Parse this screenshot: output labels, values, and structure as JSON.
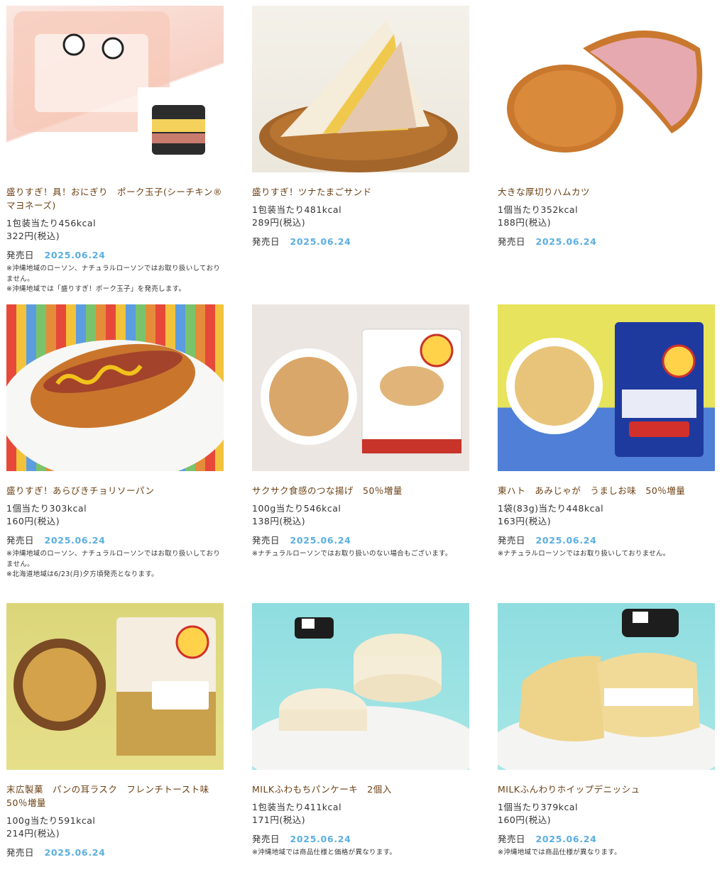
{
  "products": [
    {
      "name": "盛りすぎ！具！おにぎり　ポーク玉子(シーチキン®マヨネーズ)",
      "spec1": "1包装当たり456kcal",
      "spec2": "322円(税込)",
      "release_label": "発売日",
      "release_date": "2025.06.24",
      "notes": [
        "※沖縄地域のローソン、ナチュラルローソンではお取り扱いしておりません。",
        "※沖縄地域では「盛りすぎ！ポーク玉子」を発売します。"
      ],
      "image_icon": "onigiri-image"
    },
    {
      "name": "盛りすぎ！ツナたまごサンド",
      "spec1": "1包装当たり481kcal",
      "spec2": "289円(税込)",
      "release_label": "発売日",
      "release_date": "2025.06.24",
      "notes": [],
      "image_icon": "sandwich-image"
    },
    {
      "name": "大きな厚切りハムカツ",
      "spec1": "1個当たり352kcal",
      "spec2": "188円(税込)",
      "release_label": "発売日",
      "release_date": "2025.06.24",
      "notes": [],
      "image_icon": "ham-cutlet-image"
    },
    {
      "name": "盛りすぎ！あらびきチョリソーパン",
      "spec1": "1個当たり303kcal",
      "spec2": "160円(税込)",
      "release_label": "発売日",
      "release_date": "2025.06.24",
      "notes": [
        "※沖縄地域のローソン、ナチュラルローソンではお取り扱いしておりません。",
        "※北海道地域は6/23(月)夕方頃発売となります。"
      ],
      "image_icon": "chorizo-bread-image"
    },
    {
      "name": "サクサク食感のつな揚げ　50％増量",
      "spec1": "100g当たり546kcal",
      "spec2": "138円(税込)",
      "release_label": "発売日",
      "release_date": "2025.06.24",
      "notes": [
        "※ナチュラルローソンではお取り扱いのない場合もございます。"
      ],
      "image_icon": "snack-bag-image"
    },
    {
      "name": "東ハト　あみじゃが　うましお味　50％増量",
      "spec1": "1袋(83g)当たり448kcal",
      "spec2": "163円(税込)",
      "release_label": "発売日",
      "release_date": "2025.06.24",
      "notes": [
        "※ナチュラルローソンではお取り扱いしておりません。"
      ],
      "image_icon": "amijaga-image"
    },
    {
      "name": "末広製菓　パンの耳ラスク　フレンチトースト味　50％増量",
      "spec1": "100g当たり591kcal",
      "spec2": "214円(税込)",
      "release_label": "発売日",
      "release_date": "2025.06.24",
      "notes": [],
      "image_icon": "rusk-image"
    },
    {
      "name": "MILKふわもちパンケーキ　2個入",
      "spec1": "1包装当たり411kcal",
      "spec2": "171円(税込)",
      "release_label": "発売日",
      "release_date": "2025.06.24",
      "notes": [
        "※沖縄地域では商品仕様と価格が異なります。"
      ],
      "image_icon": "pancake-image"
    },
    {
      "name": "MILKふんわりホイップデニッシュ",
      "spec1": "1個当たり379kcal",
      "spec2": "160円(税込)",
      "release_label": "発売日",
      "release_date": "2025.06.24",
      "notes": [
        "※沖縄地域では商品仕様が異なります。"
      ],
      "image_icon": "danish-image"
    }
  ],
  "colors": {
    "name": "#6b3f12",
    "date": "#5aaee0",
    "text": "#333333"
  }
}
